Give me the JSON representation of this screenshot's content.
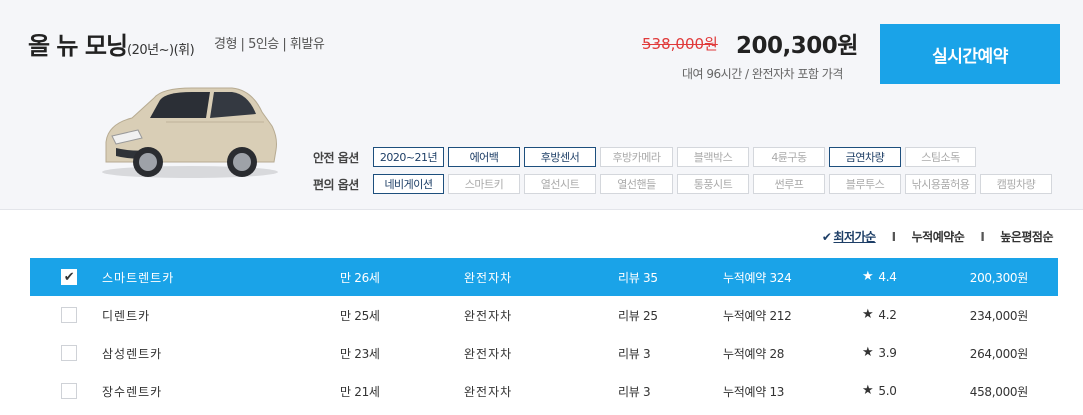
{
  "car": {
    "name": "올 뉴 모닝",
    "sub": "(20년~)(휘)",
    "spec": "경형 | 5인승 | 휘발유"
  },
  "price": {
    "original": "538,000원",
    "current": "200,300원",
    "note": "대여 96시간 / 완전자차 포함 가격"
  },
  "reserve_button": "실시간예약",
  "options": {
    "safety_label": "안전 옵션",
    "convenience_label": "편의 옵션",
    "safety": [
      {
        "label": "2020~21년",
        "active": true
      },
      {
        "label": "에어백",
        "active": true
      },
      {
        "label": "후방센서",
        "active": true
      },
      {
        "label": "후방카메라",
        "active": false
      },
      {
        "label": "블랙박스",
        "active": false
      },
      {
        "label": "4륜구동",
        "active": false
      },
      {
        "label": "금연차량",
        "active": true
      },
      {
        "label": "스팀소독",
        "active": false
      }
    ],
    "convenience": [
      {
        "label": "네비게이션",
        "active": true
      },
      {
        "label": "스마트키",
        "active": false
      },
      {
        "label": "열선시트",
        "active": false
      },
      {
        "label": "열선핸들",
        "active": false
      },
      {
        "label": "통풍시트",
        "active": false
      },
      {
        "label": "썬루프",
        "active": false
      },
      {
        "label": "블루투스",
        "active": false
      },
      {
        "label": "낚시용품허용",
        "active": false
      },
      {
        "label": "캠핑차량",
        "active": false
      }
    ]
  },
  "sort": {
    "lowest": "최저가순",
    "most_booked": "누적예약순",
    "highest_rating": "높은평점순"
  },
  "companies": [
    {
      "name": "스마트렌트카",
      "age": "만 26세",
      "insurance": "완전자차",
      "reviews": "리뷰 35",
      "total": "누적예약 324",
      "rating": "4.4",
      "price": "200,300원",
      "selected": true
    },
    {
      "name": "디렌트카",
      "age": "만 25세",
      "insurance": "완전자차",
      "reviews": "리뷰 25",
      "total": "누적예약 212",
      "rating": "4.2",
      "price": "234,000원",
      "selected": false
    },
    {
      "name": "삼성렌트카",
      "age": "만 23세",
      "insurance": "완전자차",
      "reviews": "리뷰 3",
      "total": "누적예약 28",
      "rating": "3.9",
      "price": "264,000원",
      "selected": false
    },
    {
      "name": "장수렌트카",
      "age": "만 21세",
      "insurance": "완전자차",
      "reviews": "리뷰 3",
      "total": "누적예약 13",
      "rating": "5.0",
      "price": "458,000원",
      "selected": false
    }
  ],
  "colors": {
    "accent": "#1aa3e8",
    "active_chip": "#1d4f7d",
    "strike_price": "#e03a3a"
  }
}
